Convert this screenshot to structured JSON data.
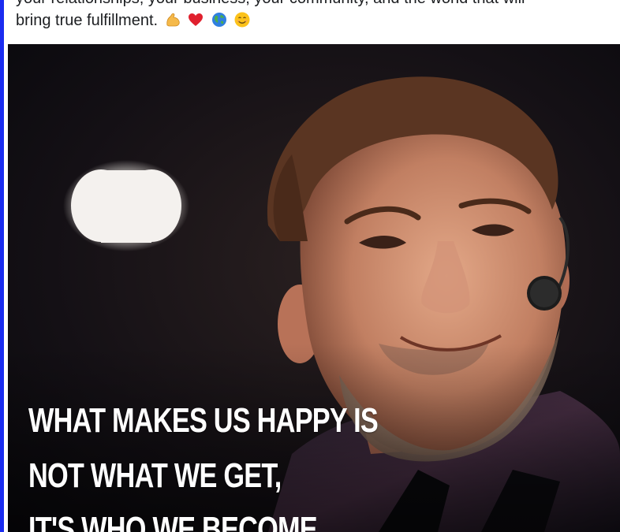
{
  "post": {
    "caption_partial": "your relationships, your business, your community, and the world that will",
    "caption_line": "bring true fulfillment.",
    "emojis": [
      "flexed-biceps-icon",
      "red-heart-icon",
      "globe-icon",
      "smiling-face-icon"
    ]
  },
  "image": {
    "quote_line_1": "WHAT MAKES US HAPPY IS",
    "quote_line_2": "NOT WHAT WE GET,",
    "quote_line_3": "IT'S WHO WE BECOME"
  },
  "colors": {
    "frame_border": "#1a2cf0",
    "caption_text": "#1c1e21",
    "quote_text": "#ffffff",
    "image_background": "#0d0d12"
  }
}
